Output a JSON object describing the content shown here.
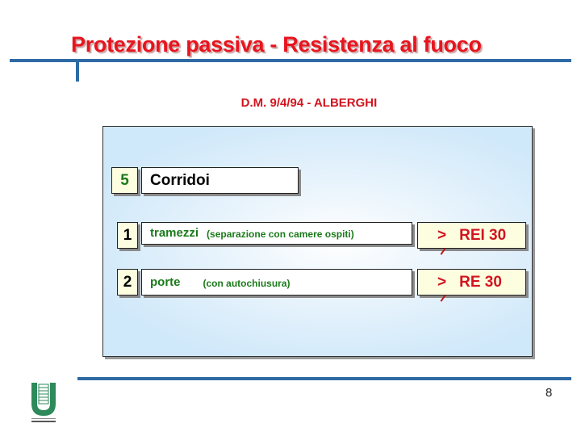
{
  "title": "Protezione passiva - Resistenza al fuoco",
  "subtitle": "D.M. 9/4/94 - ALBERGHI",
  "section": {
    "number": "5",
    "label": "Corridoi"
  },
  "rows": [
    {
      "number": "1",
      "item": "tramezzi",
      "note": "(separazione con camere ospiti)",
      "symbol": ">",
      "rating": "REI 30"
    },
    {
      "number": "2",
      "item": "porte",
      "note": "(con autochiusura)",
      "symbol": ">",
      "rating": "RE 30"
    }
  ],
  "page_number": "8",
  "colors": {
    "title": "#e8141e",
    "accent_line": "#2e6aa3",
    "item_text": "#1a7a1a",
    "rating": "#d2141e",
    "logo": "#2e8a5a"
  },
  "logo_text": "UNIVERSITA"
}
